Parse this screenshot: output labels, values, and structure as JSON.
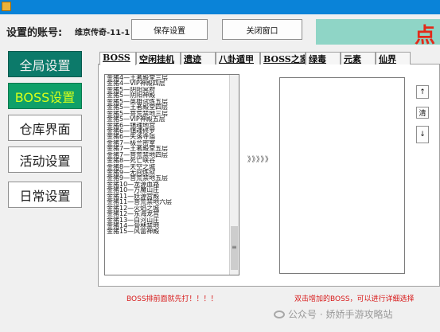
{
  "header": {
    "account_label": "设置的账号:",
    "account_value": "维京传奇-11-1",
    "save_label": "保存设置",
    "close_label": "关闭窗口",
    "status_char": "点"
  },
  "sidebar": {
    "items": [
      {
        "label": "全局设置"
      },
      {
        "label": "BOSS设置"
      },
      {
        "label": "仓库界面"
      },
      {
        "label": "活动设置"
      },
      {
        "label": "日常设置"
      }
    ]
  },
  "tabs": [
    {
      "label": "BOSS"
    },
    {
      "label": "空闲挂机"
    },
    {
      "label": "遗迹"
    },
    {
      "label": "八卦遁甲"
    },
    {
      "label": "BOSS之家"
    },
    {
      "label": "绿毒"
    },
    {
      "label": "元素"
    },
    {
      "label": "仙界"
    }
  ],
  "boss_list": [
    "金猪4—王者殿堂三层",
    "金猪4—VIP神殿四层",
    "金猪5—阴阳冥府",
    "金猪5—阴阳神殿",
    "金猪5—英雄试炼五层",
    "金猪5—王者殿堂四层",
    "金猪5—菩荒禁地三层",
    "金猪5—VIP神殿五层",
    "金猪6—镇魂地宫",
    "金猪6—镇魂修罗",
    "金猪6—失落寺庙",
    "金猪7—极兰密室",
    "金猪7—王者殿堂五层",
    "金猪7—菩荒禁地四层",
    "金猪8—死亡峡谷",
    "金猪8—天空之城",
    "金猪9—无间炼狱",
    "金猪9—菩荒禁地五层",
    "金猪10—龙源血路",
    "金猪10—万魔山庄",
    "金猪11—妖源宫殿",
    "金猪11—菩荒禁地六层",
    "金猪12—火焰之城",
    "金猪12—东海龙宫",
    "金猪13—白河山庄",
    "金猪14—骨林禁地",
    "金猪15—风雷神殿"
  ],
  "transfer_arrows": "》》》》》",
  "side_buttons": {
    "up": "↑",
    "clear": "清",
    "down": "↓"
  },
  "hints": {
    "left": "BOSS排前面就先打！！！！",
    "right": "双击增加的BOSS，可以进行详细选择"
  },
  "watermark": "公众号 · 娇娇手游攻略站",
  "colors": {
    "titlebar": "#0a83d8",
    "status_panel": "#8fd5c6",
    "status_char": "#e32a1a",
    "hint": "#d81a1a"
  }
}
